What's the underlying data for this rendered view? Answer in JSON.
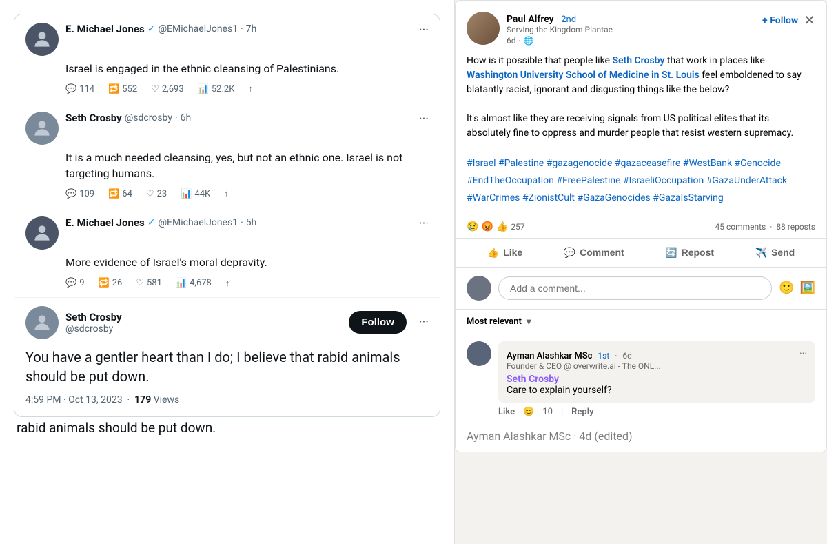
{
  "left": {
    "tweets": [
      {
        "id": "tweet-1",
        "author": "E. Michael Jones",
        "verified": true,
        "handle": "@EMichaelJones1",
        "time": "7h",
        "text": "Israel is engaged in the ethnic cleansing of Palestinians.",
        "replies": "114",
        "retweets": "552",
        "likes": "2,693",
        "views": "52.2K"
      },
      {
        "id": "tweet-2",
        "author": "Seth Crosby",
        "verified": false,
        "handle": "@sdcrosby",
        "time": "6h",
        "text": "It is a much needed cleansing, yes, but not an ethnic one. Israel is not targeting humans.",
        "replies": "109",
        "retweets": "64",
        "likes": "23",
        "views": "44K"
      },
      {
        "id": "tweet-3",
        "author": "E. Michael Jones",
        "verified": true,
        "handle": "@EMichaelJones1",
        "time": "5h",
        "text": "More evidence of Israel's moral depravity.",
        "replies": "9",
        "retweets": "26",
        "likes": "581",
        "views": "4,678"
      }
    ],
    "bottom_tweet": {
      "author": "Seth Crosby",
      "handle": "@sdcrosby",
      "follow_label": "Follow",
      "text": "You have a gentler heart than I do; I believe that rabid animals should be put down.",
      "timestamp": "4:59 PM · Oct 13, 2023",
      "views_count": "179",
      "views_label": "Views"
    }
  },
  "right": {
    "author": {
      "name": "Paul Alfrey",
      "connection": "2nd",
      "subtitle": "Serving the Kingdom Plantae",
      "time": "6d",
      "globe_icon": "🌐"
    },
    "follow_label": "+ Follow",
    "close_icon": "✕",
    "post_content": {
      "paragraph1_before": "How is it possible that people like ",
      "link1": "Seth Crosby",
      "paragraph1_mid": " that work in places like ",
      "link2": "Washington University School of Medicine in St. Louis",
      "paragraph1_after": " feel emboldened to say blatantly racist, ignorant and disgusting things like the below?",
      "paragraph2": "It's almost like they are receiving signals from US political elites that its absolutely fine to oppress and murder people that resist western supremacy.",
      "hashtags": "#Israel #Palestine #gazagenocide #gazaceasefire #WestBank #Genocide #EndTheOccupation #FreePalestine #IsraeliOccupation #GazaUnderAttack #WarCrimes #ZionistCult #GazaGenocides #GazaIsStarving"
    },
    "reactions": {
      "emoji1": "😢",
      "emoji2": "😡",
      "emoji3": "👍",
      "count": "257",
      "comments": "45 comments",
      "reposts": "88 reposts"
    },
    "action_buttons": [
      {
        "id": "like",
        "label": "Like",
        "icon": "👍"
      },
      {
        "id": "comment",
        "label": "Comment",
        "icon": "💬"
      },
      {
        "id": "repost",
        "label": "Repost",
        "icon": "🔄"
      },
      {
        "id": "send",
        "label": "Send",
        "icon": "✈️"
      }
    ],
    "comment_placeholder": "Add a comment...",
    "sort": {
      "label": "Most relevant",
      "icon": "▼"
    },
    "comments": [
      {
        "id": "comment-1",
        "author": "Ayman Alashkar MSc",
        "connection": "1st",
        "time": "6d",
        "subtitle": "Founder & CEO @ overwrite.ai - The ONL...",
        "mention": "Seth Crosby",
        "text": "Care to explain yourself?",
        "likes": "10",
        "like_label": "Like",
        "reply_label": "Reply"
      }
    ],
    "bottom_comment_partial": "Ayman Alashkar MSc · 4d (edited)"
  }
}
